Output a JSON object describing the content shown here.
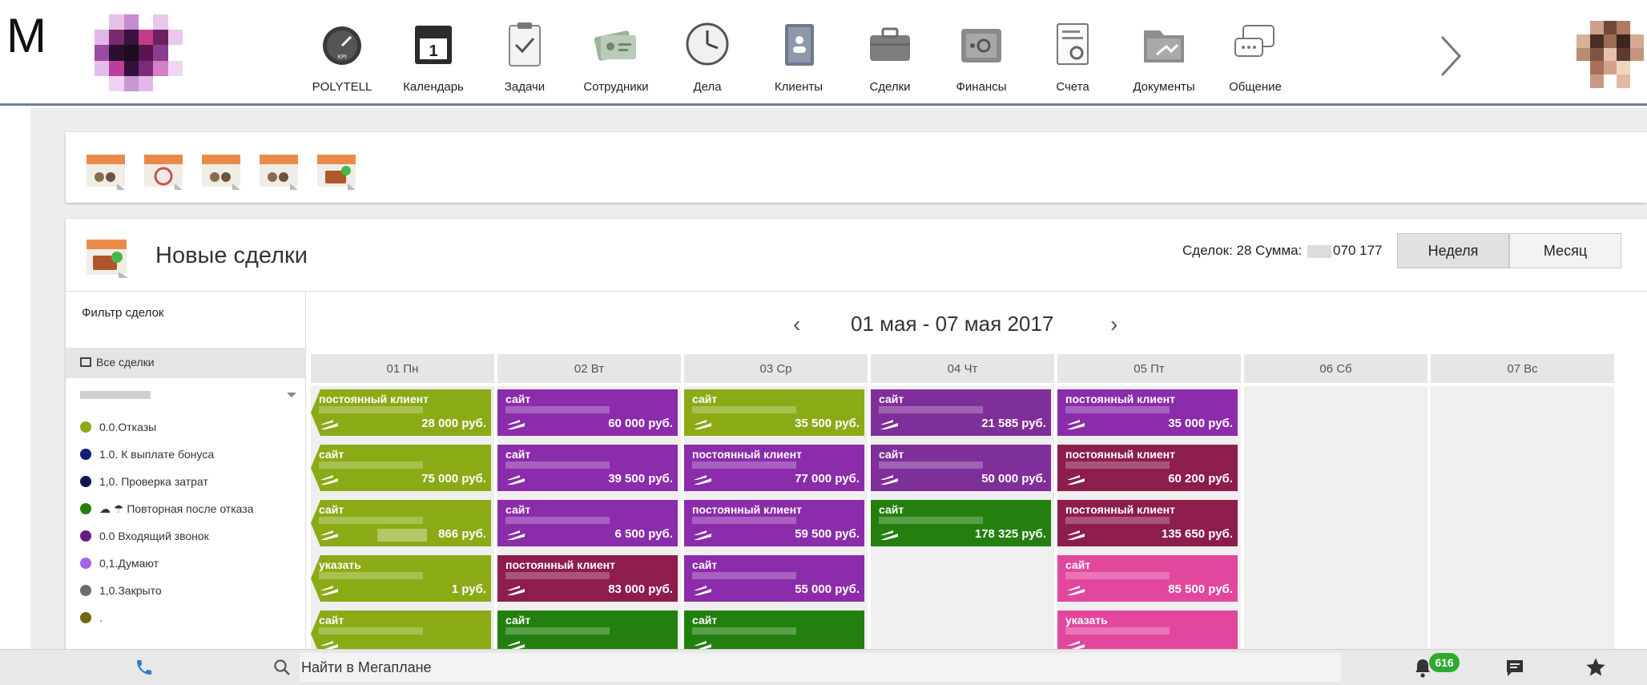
{
  "corner_letter": "M",
  "colors": {
    "header_border": "#6d8192",
    "green": "#8aab16",
    "purple": "#8b2cab",
    "violet": "#7f2f9a",
    "dark_green": "#23800f",
    "maroon": "#8d1d4c",
    "pink": "#e2479e",
    "badge_green": "#2eab2e"
  },
  "nav": {
    "items": [
      {
        "label": "POLYTELL",
        "icon": "speedometer-icon"
      },
      {
        "label": "Календарь",
        "icon": "calendar-icon"
      },
      {
        "label": "Задачи",
        "icon": "clipboard-check-icon"
      },
      {
        "label": "Сотрудники",
        "icon": "id-cards-icon"
      },
      {
        "label": "Дела",
        "icon": "clock-icon"
      },
      {
        "label": "Клиенты",
        "icon": "contact-book-icon"
      },
      {
        "label": "Сделки",
        "icon": "briefcase-icon"
      },
      {
        "label": "Финансы",
        "icon": "safe-icon"
      },
      {
        "label": "Счета",
        "icon": "invoice-icon"
      },
      {
        "label": "Документы",
        "icon": "folder-icon"
      },
      {
        "label": "Общение",
        "icon": "chat-bubbles-icon"
      }
    ],
    "next_icon": "chevron-right-icon"
  },
  "deals": {
    "title": "Новые сделки",
    "summary_prefix": "Сделок: 28 Сумма: ",
    "summary_suffix": "070 177",
    "week_label": "Неделя",
    "month_label": "Месяц",
    "range": "01 мая - 07 мая 2017",
    "prev": "‹",
    "next": "›"
  },
  "filter": {
    "title": "Фильтр сделок",
    "all_label": "Все сделки",
    "items": [
      {
        "label": "0.0.Отказы",
        "color": "#8aab16"
      },
      {
        "label": "1.0. К выплате бонуса",
        "color": "#121c7a"
      },
      {
        "label": "1,0. Проверка затрат",
        "color": "#0e1650"
      },
      {
        "label": "☁ ☂ Повторная после отказа",
        "color": "#23800f"
      },
      {
        "label": "0.0 Входящий звонок",
        "color": "#6a1b8a"
      },
      {
        "label": "0,1.Думают",
        "color": "#a463e8"
      },
      {
        "label": "1,0.Закрыто",
        "color": "#6b6b6b"
      },
      {
        "label": ".",
        "color": "#6f6a12"
      }
    ]
  },
  "calendar": {
    "days": [
      {
        "label": "01 Пн",
        "deals": [
          {
            "source": "постоянный клиент",
            "amount": "28 000 руб.",
            "color": "#8aab16"
          },
          {
            "source": "сайт",
            "amount": "75 000 руб.",
            "color": "#8aab16"
          },
          {
            "source": "сайт",
            "amount": "866 руб.",
            "color": "#8aab16"
          },
          {
            "source": "указать",
            "amount": "1 руб.",
            "color": "#8aab16"
          },
          {
            "source": "сайт",
            "amount": "",
            "color": "#8aab16"
          }
        ]
      },
      {
        "label": "02 Вт",
        "deals": [
          {
            "source": "сайт",
            "amount": "60 000 руб.",
            "color": "#8b2cab"
          },
          {
            "source": "сайт",
            "amount": "39 500 руб.",
            "color": "#8b2cab"
          },
          {
            "source": "сайт",
            "amount": "6 500 руб.",
            "color": "#8b2cab"
          },
          {
            "source": "постоянный клиент",
            "amount": "83 000 руб.",
            "color": "#8d1d4c"
          },
          {
            "source": "сайт",
            "amount": "",
            "color": "#23800f"
          }
        ]
      },
      {
        "label": "03 Ср",
        "deals": [
          {
            "source": "сайт",
            "amount": "35 500 руб.",
            "color": "#8aab16"
          },
          {
            "source": "постоянный клиент",
            "amount": "77 000 руб.",
            "color": "#8b2cab"
          },
          {
            "source": "постоянный клиент",
            "amount": "59 500 руб.",
            "color": "#8b2cab"
          },
          {
            "source": "сайт",
            "amount": "55 000 руб.",
            "color": "#8b2cab"
          },
          {
            "source": "сайт",
            "amount": "",
            "color": "#23800f"
          }
        ]
      },
      {
        "label": "04 Чт",
        "deals": [
          {
            "source": "сайт",
            "amount": "21 585 руб.",
            "color": "#7f2f9a"
          },
          {
            "source": "сайт",
            "amount": "50 000 руб.",
            "color": "#7f2f9a"
          },
          {
            "source": "сайт",
            "amount": "178 325 руб.",
            "color": "#23800f"
          }
        ]
      },
      {
        "label": "05 Пт",
        "deals": [
          {
            "source": "постоянный клиент",
            "amount": "35 000 руб.",
            "color": "#8b2cab"
          },
          {
            "source": "постоянный клиент",
            "amount": "60 200 руб.",
            "color": "#8d1d4c"
          },
          {
            "source": "постоянный клиент",
            "amount": "135 650 руб.",
            "color": "#8d1d4c"
          },
          {
            "source": "сайт",
            "amount": "85 500 руб.",
            "color": "#e2479e"
          },
          {
            "source": "указать",
            "amount": "",
            "color": "#e2479e"
          }
        ]
      },
      {
        "label": "06 Сб",
        "deals": []
      },
      {
        "label": "07 Вс",
        "deals": []
      }
    ]
  },
  "bottom": {
    "search_placeholder": "Найти в Мегаплане",
    "notifications": "616"
  }
}
